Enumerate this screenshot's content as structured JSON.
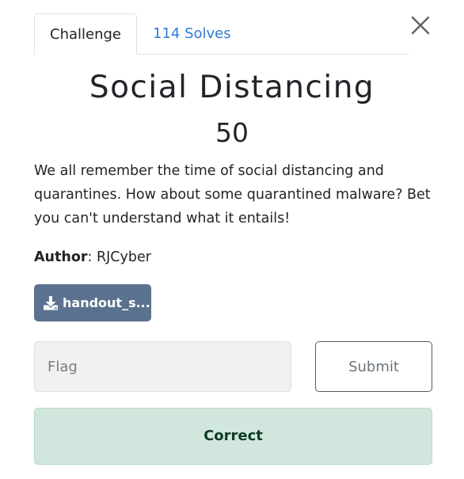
{
  "tabs": [
    {
      "label": "Challenge",
      "active": true
    },
    {
      "label": "114 Solves",
      "active": false
    }
  ],
  "close_icon": "close-icon",
  "challenge": {
    "title": "Social Distancing",
    "points": "50",
    "description": "We all remember the time of social distancing and quarantines. How about some quarantined malware? Bet you can't understand what it entails!",
    "author_label": "Author",
    "author_value": ": RJCyber"
  },
  "download": {
    "icon": "download-icon",
    "label": "handout_s..."
  },
  "flag_input": {
    "placeholder": "Flag",
    "value": ""
  },
  "submit_label": "Submit",
  "result": {
    "text": "Correct",
    "color": "#d1e7dd"
  },
  "colors": {
    "link": "#2f7ad6",
    "download_button": "#5b728f",
    "success_bg": "#d1e7dd"
  }
}
